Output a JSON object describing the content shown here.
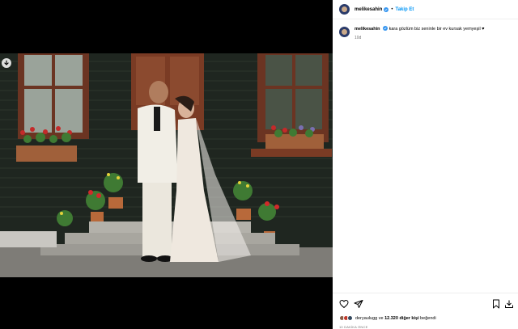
{
  "post": {
    "username": "melikesahin",
    "separator": "•",
    "follow_label": "Takip Et",
    "caption": "kara gözlüm biz seninle bir ev kursak yemyeşil ♥",
    "caption_time": "10d",
    "likes_user": "deryaulugg",
    "likes_middle": " ve ",
    "likes_count": "12.320 diğer kişi",
    "likes_suffix": " beğendi",
    "time_ago": "10 DAKİKA ÖNCE"
  },
  "icons": {
    "verified": "verified-badge-icon",
    "download": "download-icon",
    "heart": "heart-icon",
    "share": "paper-plane-icon",
    "save": "bookmark-icon",
    "save_to_device": "download-tray-icon"
  },
  "colors": {
    "accent": "#0095f6",
    "verified": "#3897f0",
    "muted": "#737373"
  }
}
